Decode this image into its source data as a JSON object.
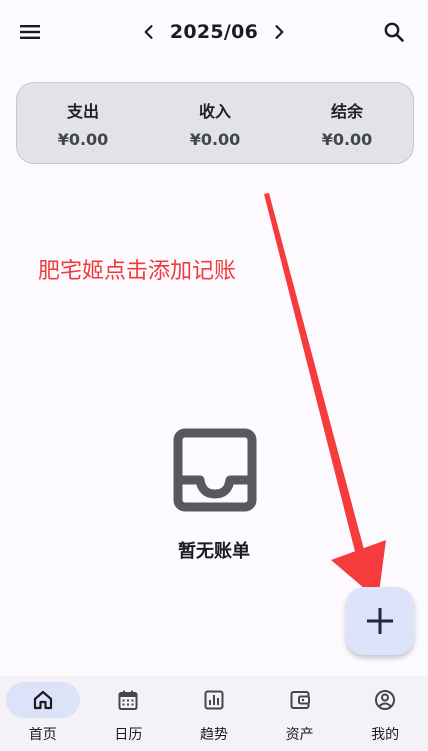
{
  "header": {
    "menu_icon": "menu-icon",
    "prev_icon": "chevron-left-icon",
    "month": "2025/06",
    "next_icon": "chevron-right-icon",
    "search_icon": "search-icon"
  },
  "summary": {
    "expense": {
      "label": "支出",
      "amount": "¥0.00"
    },
    "income": {
      "label": "收入",
      "amount": "¥0.00"
    },
    "balance": {
      "label": "结余",
      "amount": "¥0.00"
    }
  },
  "annotation": {
    "text": "肥宅姬点击添加记账",
    "color": "#ef3b3b"
  },
  "empty_state": {
    "icon": "inbox-icon",
    "text": "暂无账单"
  },
  "fab": {
    "icon": "plus-icon"
  },
  "bottom_nav": {
    "items": [
      {
        "label": "首页",
        "icon": "home-icon",
        "active": true
      },
      {
        "label": "日历",
        "icon": "calendar-icon",
        "active": false
      },
      {
        "label": "趋势",
        "icon": "chart-icon",
        "active": false
      },
      {
        "label": "资产",
        "icon": "wallet-icon",
        "active": false
      },
      {
        "label": "我的",
        "icon": "account-icon",
        "active": false
      }
    ]
  },
  "colors": {
    "accent": "#dce2f7",
    "summary_bg": "#e2e3e8",
    "annotation": "#ef3b3b"
  }
}
